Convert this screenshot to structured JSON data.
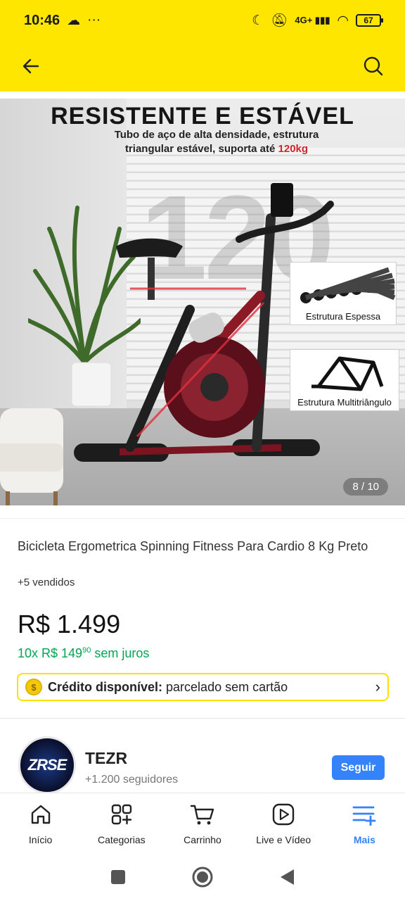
{
  "status": {
    "time": "10:46",
    "battery": "67"
  },
  "gallery": {
    "headline": "RESISTENTE E ESTÁVEL",
    "subline_1": "Tubo de aço de alta densidade, estrutura",
    "subline_2": "triangular estável, suporta até",
    "subline_weight": "120kg",
    "inset_1_caption": "Estrutura Espessa",
    "inset_2_caption": "Estrutura Multitriângulo",
    "counter": "8 / 10"
  },
  "product": {
    "title": "Bicicleta Ergometrica Spinning Fitness Para Cardio 8 Kg Preto",
    "sold": "+5 vendidos",
    "price": "R$ 1.499",
    "installments_prefix": "10x R$ 149",
    "installments_cents": "90",
    "installments_suffix": "sem juros",
    "credit_bold": "Crédito disponível:",
    "credit_text": "parcelado sem cartão"
  },
  "seller": {
    "logo_text": "ZRSE",
    "name": "TEZR",
    "followers": "+1.200 seguidores",
    "follow_label": "Seguir"
  },
  "tabs": [
    {
      "label": "Início",
      "icon": "home-icon"
    },
    {
      "label": "Categorias",
      "icon": "categories-icon"
    },
    {
      "label": "Carrinho",
      "icon": "cart-icon"
    },
    {
      "label": "Live e Vídeo",
      "icon": "play-icon"
    },
    {
      "label": "Mais",
      "icon": "menu-plus-icon"
    }
  ],
  "colors": {
    "header": "#ffe600",
    "accent": "#3483fa",
    "green": "#00a650"
  }
}
